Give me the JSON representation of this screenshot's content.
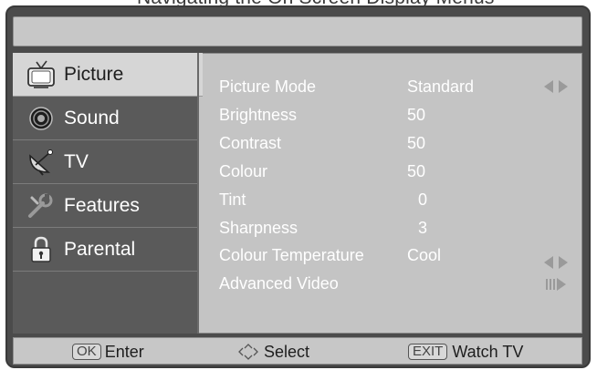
{
  "caption": "Navigating the On Screen Display Menus",
  "menu": {
    "categories": [
      {
        "label": "Picture",
        "icon": "tv-monitor-icon",
        "active": true
      },
      {
        "label": "Sound",
        "icon": "speaker-icon",
        "active": false
      },
      {
        "label": "TV",
        "icon": "satellite-dish-icon",
        "active": false
      },
      {
        "label": "Features",
        "icon": "wrench-icon",
        "active": false
      },
      {
        "label": "Parental",
        "icon": "padlock-icon",
        "active": false
      }
    ],
    "settings": [
      {
        "label": "Picture Mode",
        "value": "Standard",
        "control": "left-right-arrows-icon"
      },
      {
        "label": "Brightness",
        "value": "50"
      },
      {
        "label": "Contrast",
        "value": "50"
      },
      {
        "label": "Colour",
        "value": "50"
      },
      {
        "label": "Tint",
        "value": "0"
      },
      {
        "label": "Sharpness",
        "value": "3"
      },
      {
        "label": "Colour Temperature",
        "value": "Cool",
        "control": "left-right-arrows-icon"
      },
      {
        "label": "Advanced Video",
        "value": "",
        "control": "enter-submenu-icon"
      }
    ]
  },
  "footer": {
    "enter_key": "OK",
    "enter_label": "Enter",
    "select_label": "Select",
    "exit_key": "EXIT",
    "exit_label": "Watch TV"
  },
  "colors": {
    "frame": "#4b4b4b",
    "panel": "#c4c4c4",
    "active_tab": "#d6d6d6",
    "text": "#ffffff"
  }
}
